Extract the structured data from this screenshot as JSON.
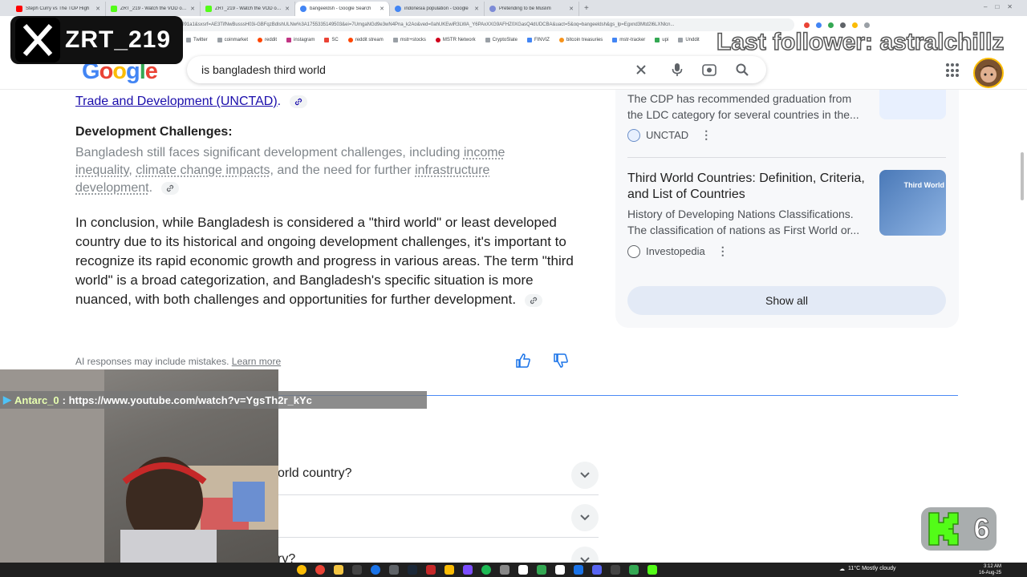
{
  "browser": {
    "tabs": [
      {
        "title": "Steph Curry vs The TOP High",
        "color": "#ff0000"
      },
      {
        "title": "ZRT_219 - Watch the VOD on K",
        "color": "#53fc18"
      },
      {
        "title": "ZRT_219 - Watch the VOD on K",
        "color": "#53fc18"
      },
      {
        "title": "bangeeldsh - Google Search",
        "color": "#4285f4",
        "active": true
      },
      {
        "title": "indonesia population - Google",
        "color": "#4285f4"
      },
      {
        "title": "Pretending to be Muslim",
        "color": "#7d8bd6"
      }
    ],
    "new_tab": "+",
    "url": "google.com/search?q=bangeeldsh&sca_esv=...bd5bace73091a1&sxsrf=AE3TifNwBusssH03i-GBFqzBdlshULNw%3A1755335149503&ei=7UmgaNGd9e3wN4Pna_k2Ao&ved=0ahUKEwiR3LWA_Y6PAxXXG9AFHZ0XGasQ4dUDCBA&uact=5&oq=bangeeldsh&gs_lp=Egxnd3Mtd2l6LXNlcn...",
    "bookmarks": [
      "Twitter",
      "coinmarket",
      "reddit",
      "instagram",
      "SC",
      "reddit stream",
      "mstr+stocks",
      "MSTR Network",
      "CryptoSlate",
      "FINVIZ",
      "bitcoin treasuries",
      "mstr-tracker",
      "upi",
      "Unddit"
    ]
  },
  "search": {
    "logo": "Google",
    "query": "is bangladesh third world"
  },
  "ai_overview": {
    "link_text": "Trade and Development (UNCTAD)",
    "link_suffix": ".",
    "section_title": "Development Challenges:",
    "challenge_parts": {
      "p1": "Bangladesh still faces significant development challenges, including ",
      "u1": "income inequality",
      "p2": ", ",
      "u2": "climate change impacts",
      "p3": ", and the need for further ",
      "u3": "infrastructure development",
      "p4": "."
    },
    "conclusion": "In conclusion, while Bangladesh is considered a \"third world\" or least developed country due to its historical and ongoing development challenges, it's important to recognize its rapid economic growth and progress in various areas. The term \"third world\" is a broad categorization, and Bangladesh's specific situation is more nuanced, with both challenges and opportunities for further development.",
    "disclaimer": "AI responses may include mistakes.",
    "learn_more": "Learn more"
  },
  "people_also_ask": [
    {
      "question": "orld country?"
    },
    {
      "question": ""
    },
    {
      "question": "ry?"
    }
  ],
  "sources_panel": {
    "card1_snippet": "The CDP has recommended graduation from the LDC category for several countries in the...",
    "card1_source": "UNCTAD",
    "card2_title": "Third World Countries: Definition, Criteria, and List of Countries",
    "card2_snippet": "History of Developing Nations Classifications. The classification of nations as First World or...",
    "card2_source": "Investopedia",
    "card2_thumb_text": "Third World",
    "show_all": "Show all"
  },
  "overlays": {
    "x_handle": "ZRT_219",
    "last_follower": "Last follower: astralchillz",
    "chat_user": "Antarc_0",
    "chat_separator": ":",
    "chat_message": "https://www.youtube.com/watch?v=YgsTh2r_kYc",
    "kick_count": "6"
  },
  "taskbar": {
    "weather": "11°C  Mostly cloudy",
    "time": "3:12 AM",
    "date": "16-Aug-25"
  },
  "colors": {
    "link": "#1a0dab",
    "google_blue": "#4285f4",
    "google_red": "#ea4335",
    "google_yellow": "#fbbc05",
    "google_green": "#34a853",
    "kick_green": "#53fc18"
  }
}
